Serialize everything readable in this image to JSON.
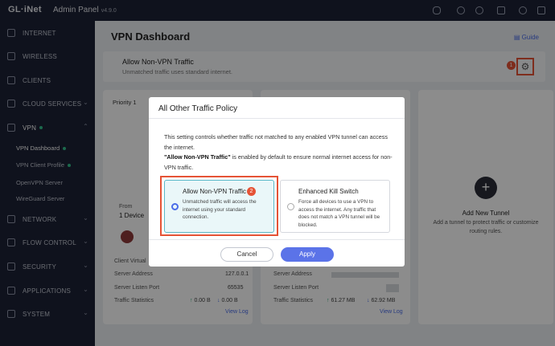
{
  "brand": "GL·iNet",
  "topbar": {
    "title": "Admin Panel",
    "version": "v4.9.0"
  },
  "sidebar": {
    "items": [
      {
        "label": "INTERNET",
        "icon": "globe-icon"
      },
      {
        "label": "WIRELESS",
        "icon": "wifi-icon"
      },
      {
        "label": "CLIENTS",
        "icon": "monitor-icon"
      },
      {
        "label": "CLOUD SERVICES",
        "icon": "cloud-icon"
      },
      {
        "label": "VPN",
        "icon": "shield-icon"
      },
      {
        "label": "NETWORK",
        "icon": "network-icon"
      },
      {
        "label": "FLOW CONTROL",
        "icon": "flow-icon"
      },
      {
        "label": "SECURITY",
        "icon": "lock-icon"
      },
      {
        "label": "APPLICATIONS",
        "icon": "apps-icon"
      },
      {
        "label": "SYSTEM",
        "icon": "gear-icon"
      }
    ],
    "vpn_sub": [
      "VPN Dashboard",
      "VPN Client Profile",
      "OpenVPN Server",
      "WireGuard Server"
    ]
  },
  "main": {
    "title": "VPN Dashboard",
    "guide": "Guide",
    "banner": {
      "title": "Allow Non-VPN Traffic",
      "subtitle": "Unmatched traffic uses standard internet.",
      "badge": "1"
    },
    "card1": {
      "priority": "Priority 1",
      "from_label": "From",
      "from_value": "1 Device",
      "client_virtual": "Client Virtual",
      "server_address_label": "Server Address",
      "server_address": "127.0.0.1",
      "listen_port_label": "Server Listen Port",
      "listen_port": "65535",
      "traffic_label": "Traffic Statistics",
      "up": "0.00 B",
      "down": "0.00 B",
      "view_log": "View Log"
    },
    "card2": {
      "server_address_label": "Server Address",
      "listen_port_label": "Server Listen Port",
      "traffic_label": "Traffic Statistics",
      "up": "61.27 MB",
      "down": "62.92 MB",
      "view_log": "View Log"
    },
    "add_tunnel": {
      "title": "Add New Tunnel",
      "desc": "Add a tunnel to protect traffic or customize routing rules."
    }
  },
  "modal": {
    "title": "All Other Traffic Policy",
    "text1": "This setting controls whether traffic not matched to any enabled VPN tunnel can access the internet.",
    "text2_bold": "\"Allow Non-VPN Traffic\"",
    "text2_rest": " is enabled by default to ensure normal internet access for non-VPN traffic.",
    "option1": {
      "title": "Allow Non-VPN Traffic",
      "badge": "2",
      "desc": "Unmatched traffic will access the internet using your standard connection."
    },
    "option2": {
      "title": "Enhanced Kill Switch",
      "desc": "Force all devices to use a VPN to access the internet. Any traffic that does not match a VPN tunnel will be blocked."
    },
    "cancel": "Cancel",
    "apply": "Apply"
  }
}
